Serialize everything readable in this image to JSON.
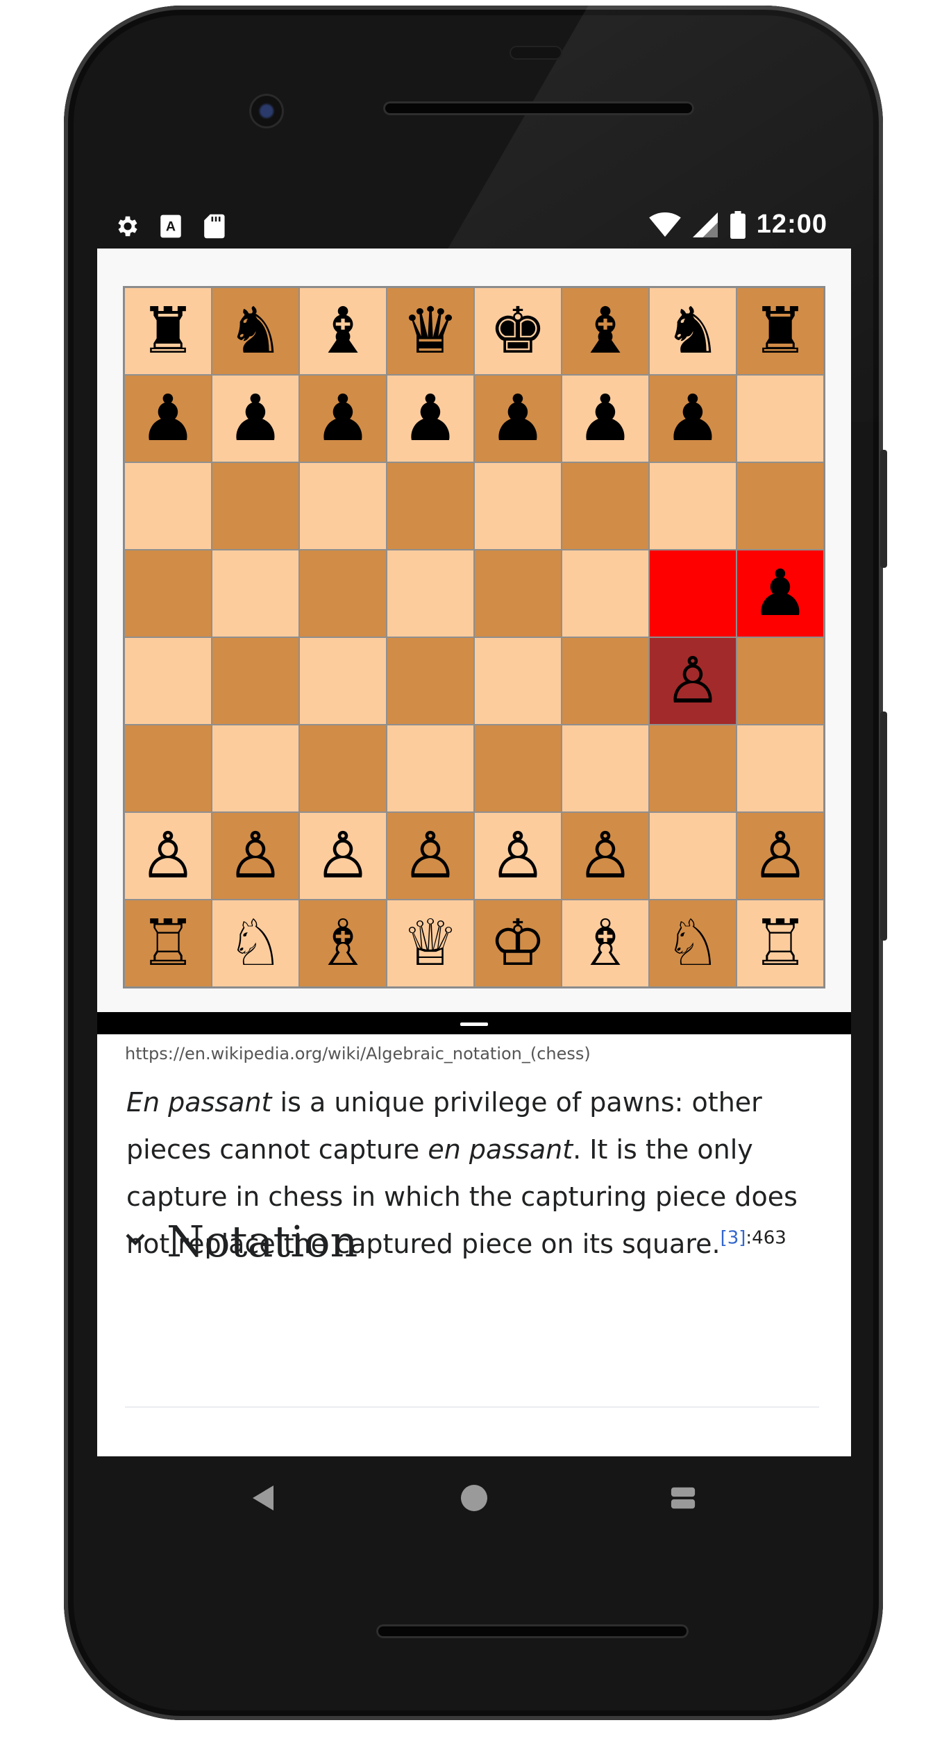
{
  "status_bar": {
    "time": "12:00",
    "left_icons": [
      "gear-icon",
      "font-a-icon",
      "sd-card-icon"
    ],
    "right_icons": [
      "wifi-icon",
      "signal-icon",
      "battery-icon"
    ]
  },
  "board": {
    "colors": {
      "light": "#fdcc9d",
      "dark": "#d18c47",
      "highlight_red": "#ff0000",
      "highlight_dark": "#a32a2a"
    },
    "ranks": [
      [
        "♜",
        "♞",
        "♝",
        "♛",
        "♚",
        "♝",
        "♞",
        "♜"
      ],
      [
        "♟",
        "♟",
        "♟",
        "♟",
        "♟",
        "♟",
        "♟",
        ""
      ],
      [
        "",
        "",
        "",
        "",
        "",
        "",
        "",
        ""
      ],
      [
        "",
        "",
        "",
        "",
        "",
        "",
        "",
        "♟"
      ],
      [
        "",
        "",
        "",
        "",
        "",
        "",
        "♙",
        ""
      ],
      [
        "",
        "",
        "",
        "",
        "",
        "",
        "",
        ""
      ],
      [
        "♙",
        "♙",
        "♙",
        "♙",
        "♙",
        "♙",
        "",
        "♙"
      ],
      [
        "♖",
        "♘",
        "♗",
        "♕",
        "♔",
        "♗",
        "♘",
        "♖"
      ]
    ],
    "highlights": [
      {
        "rank": 3,
        "file": 6,
        "style": "red"
      },
      {
        "rank": 3,
        "file": 7,
        "style": "red"
      },
      {
        "rank": 4,
        "file": 6,
        "style": "dark"
      }
    ]
  },
  "article": {
    "url": "https://en.wikipedia.org/wiki/Algebraic_notation_(chess)",
    "p1": "En passant",
    "p2": " is a unique privilege of pawns: other pieces cannot capture ",
    "p3": "en passant",
    "p4": ". It is the only capture in chess in which the capturing piece does not replace the captured piece on its square.",
    "cite": "[3]",
    "cite_page": ":463",
    "section_title": "Notation"
  },
  "nav_bar": {
    "buttons": [
      "back-icon",
      "home-icon",
      "recents-icon"
    ]
  }
}
